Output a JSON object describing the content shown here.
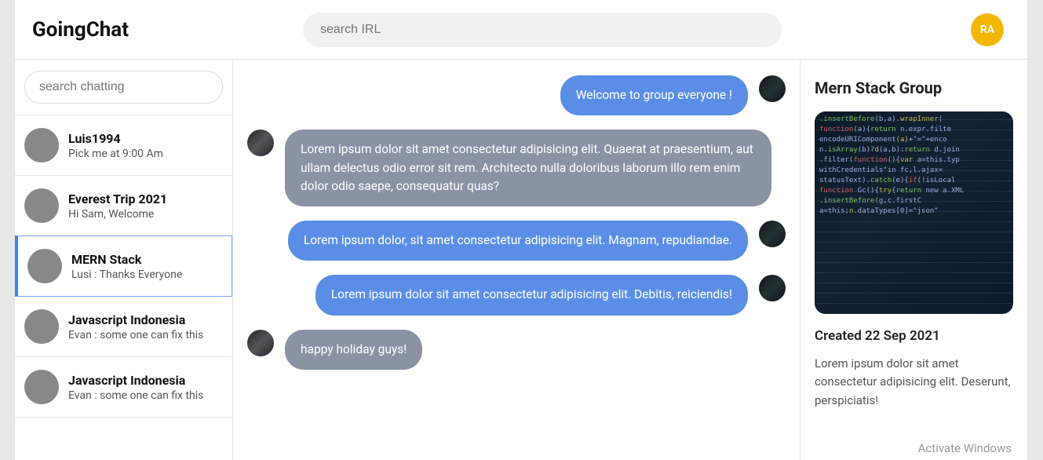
{
  "header": {
    "brand": "GoingChat",
    "search_placeholder": "search IRL",
    "avatar_initials": "RA"
  },
  "sidebar": {
    "search_placeholder": "search chatting",
    "items": [
      {
        "name": "Luis1994",
        "preview": "Pick me at 9:00 Am",
        "avatar_class": "av-photo",
        "active": false
      },
      {
        "name": "Everest Trip 2021",
        "preview": "Hi Sam, Welcome",
        "avatar_class": "av-mount",
        "active": false
      },
      {
        "name": "MERN Stack",
        "preview": "Lusi : Thanks Everyone",
        "avatar_class": "av-code",
        "active": true
      },
      {
        "name": "Javascript Indonesia",
        "preview": "Evan : some one can fix this",
        "avatar_class": "av-js",
        "active": false
      },
      {
        "name": "Javascript Indonesia",
        "preview": "Evan : some one can fix this",
        "avatar_class": "av-js",
        "active": false
      }
    ]
  },
  "messages": [
    {
      "side": "right",
      "color": "blue",
      "avatar_class": "av-code",
      "text": "Welcome to group everyone !"
    },
    {
      "side": "left",
      "color": "gray",
      "avatar_class": "av-js",
      "text": "Lorem ipsum dolor sit amet consectetur adipisicing elit. Quaerat at praesentium, aut ullam delectus odio error sit rem. Architecto nulla doloribus laborum illo rem enim dolor odio saepe, consequatur quas?"
    },
    {
      "side": "right",
      "color": "blue",
      "avatar_class": "av-code",
      "text": "Lorem ipsum dolor, sit amet consectetur adipisicing elit. Magnam, repudiandae."
    },
    {
      "side": "right",
      "color": "blue",
      "avatar_class": "av-code",
      "text": "Lorem ipsum dolor sit amet consectetur adipisicing elit. Debitis, reiciendis!"
    },
    {
      "side": "left",
      "color": "gray",
      "avatar_class": "av-js",
      "text": "happy holiday guys!"
    }
  ],
  "aside": {
    "title": "Mern Stack Group",
    "created": "Created 22 Sep 2021",
    "description": "Lorem ipsum dolor sit amet consectetur adipisicing elit. Deserunt, perspiciatis!"
  },
  "watermark": "Activate Windows"
}
